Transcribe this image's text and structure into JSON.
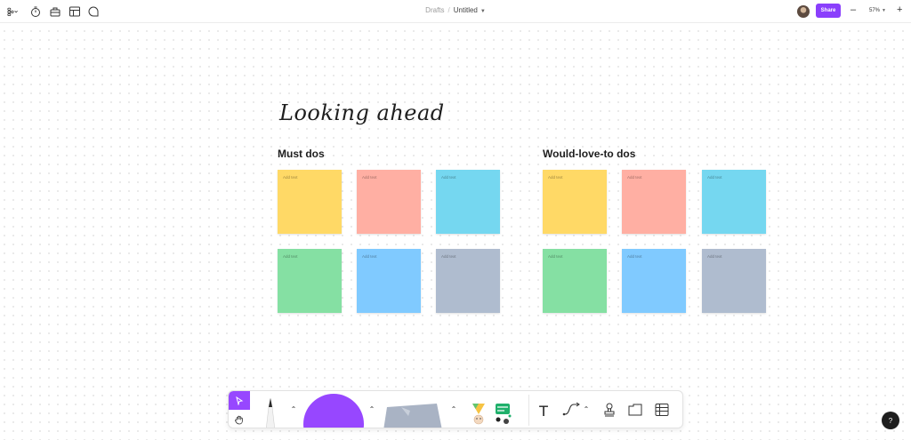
{
  "header": {
    "breadcrumb_parent": "Drafts",
    "breadcrumb_separator": "/",
    "file_name": "Untitled",
    "share_label": "Share",
    "zoom_level": "57%",
    "zoom_minus": "–",
    "zoom_plus": "+"
  },
  "board": {
    "headline": "Looking ahead",
    "sections": [
      {
        "title": "Must dos"
      },
      {
        "title": "Would-love-to dos"
      }
    ],
    "sticky_placeholder": "Add text",
    "sticky_colors": [
      "#ffd966",
      "#ffafa3",
      "#75d7f0",
      "#85e0a3",
      "#80caff",
      "#afbccf"
    ]
  },
  "toolbar": {
    "text_tool_label": "T",
    "shape_color": "#9747ff"
  },
  "help": {
    "label": "?"
  }
}
